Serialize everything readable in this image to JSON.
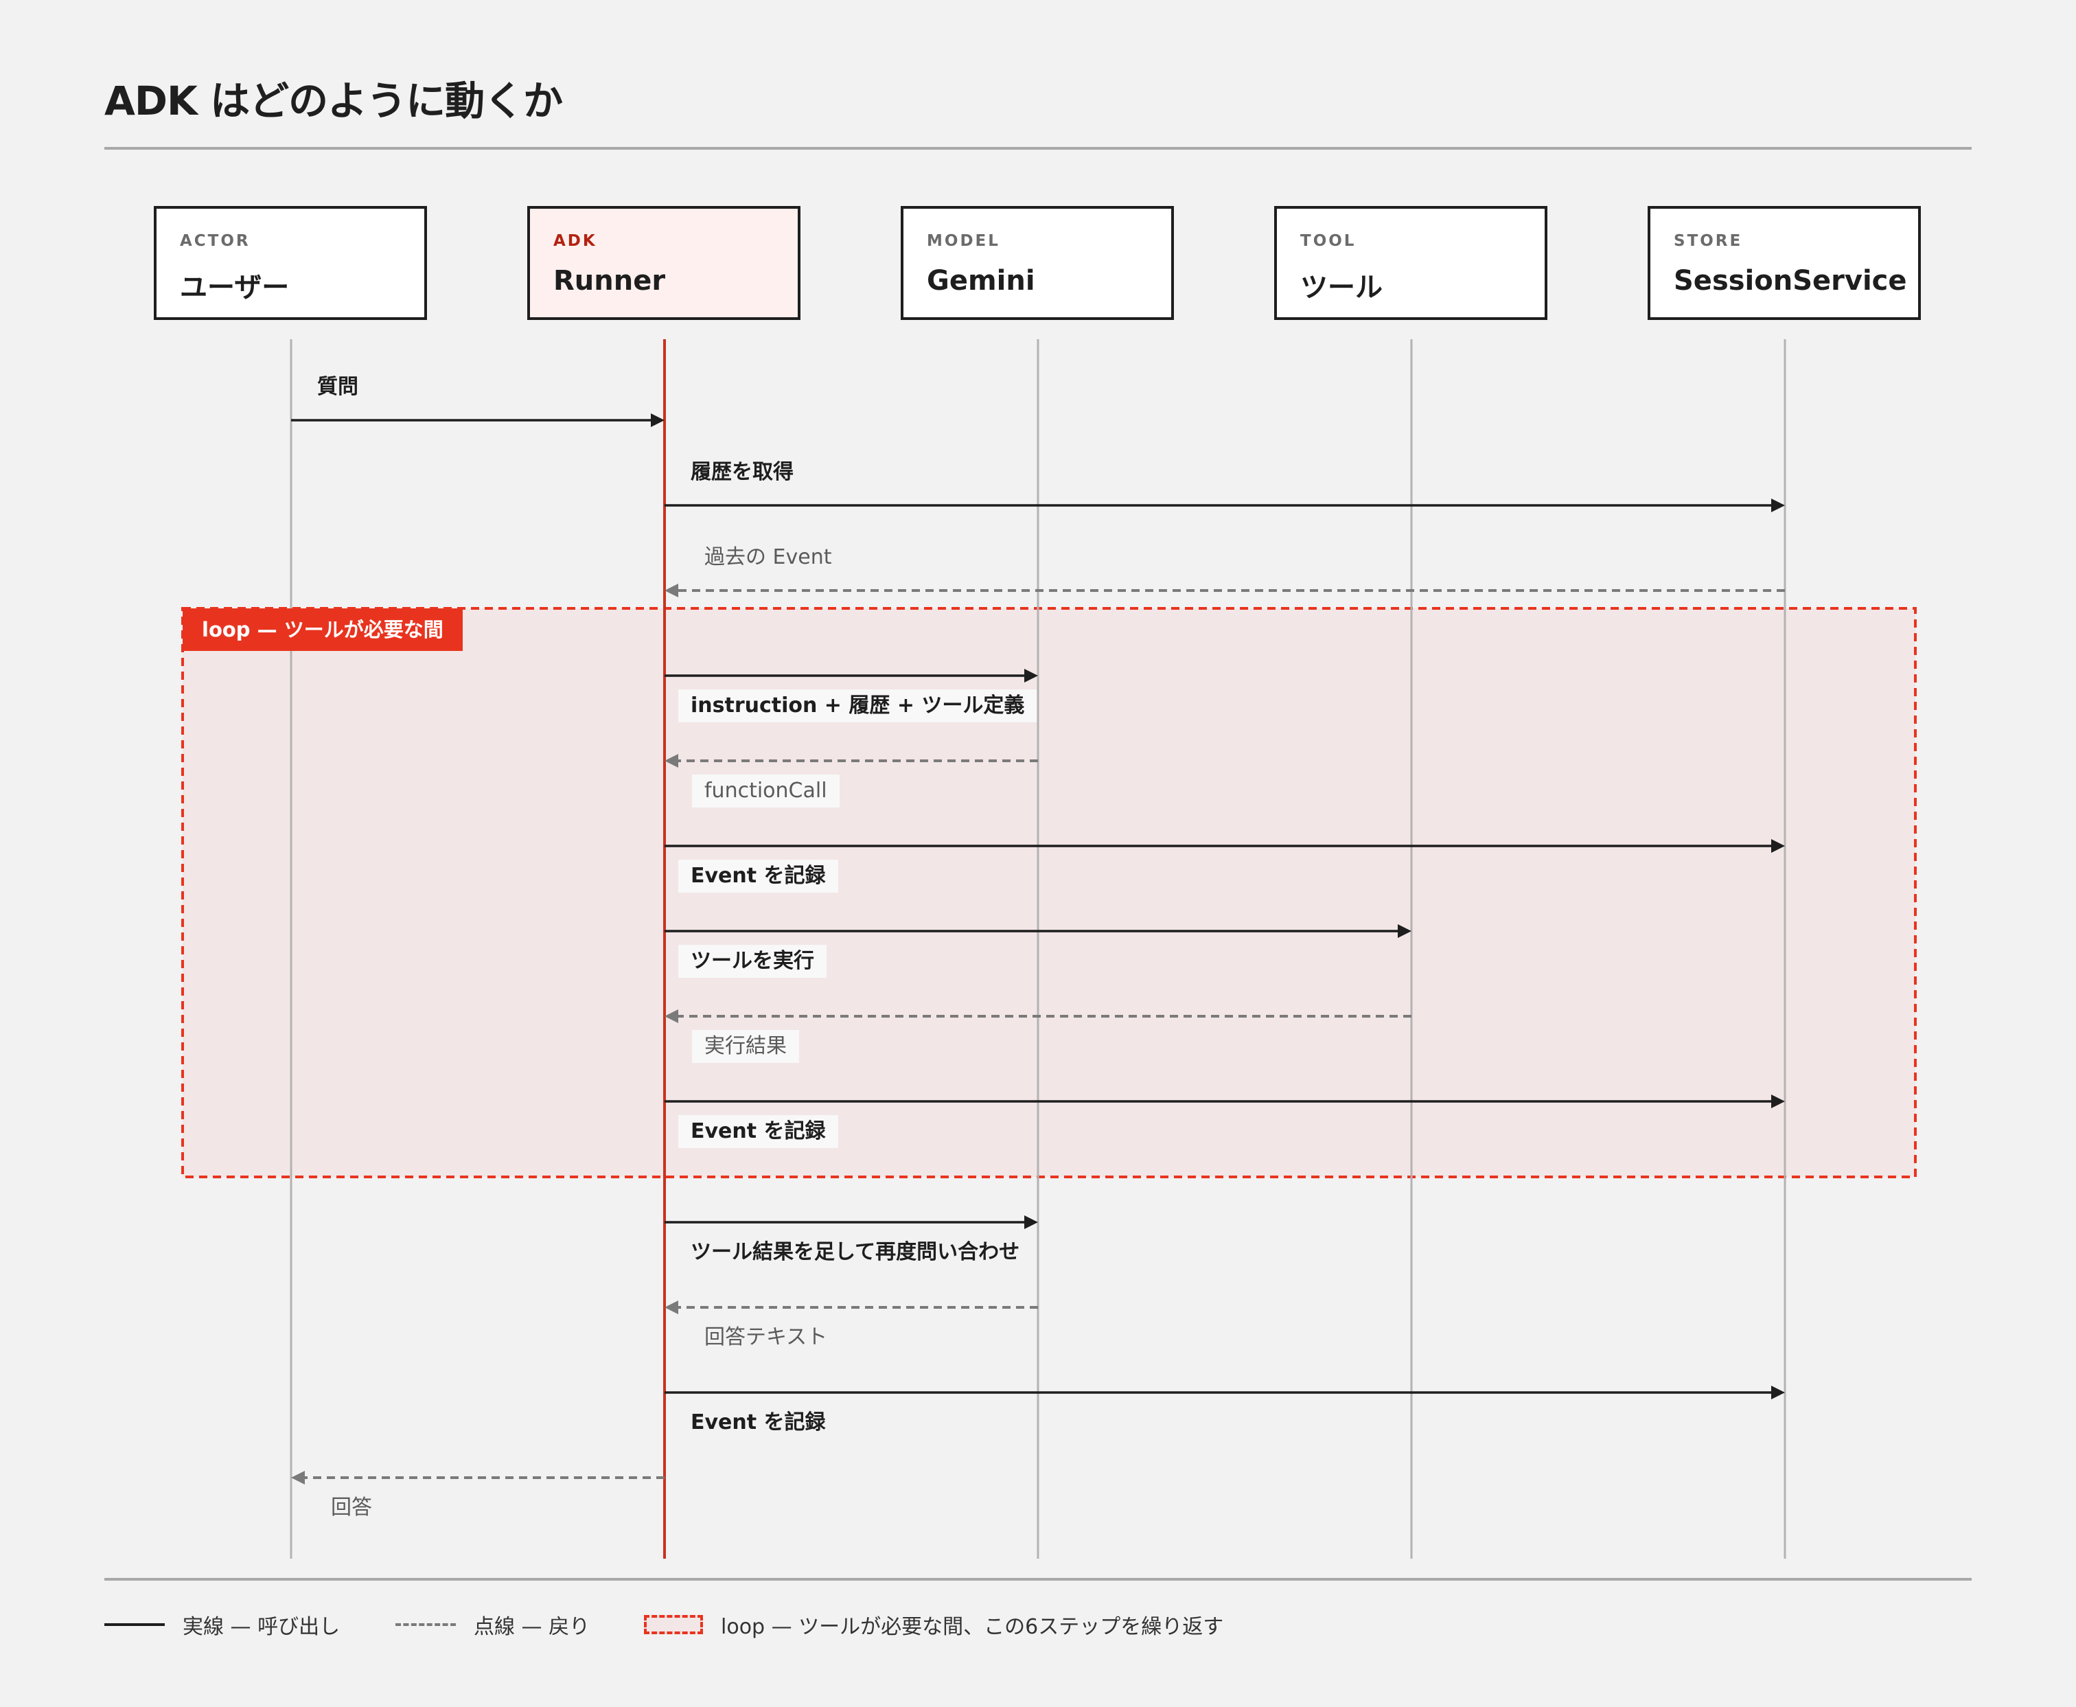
{
  "title": "ADK はどのように動くか",
  "actors": [
    {
      "kicker": "ACTOR",
      "name": "ユーザー"
    },
    {
      "kicker": "ADK",
      "name": "Runner"
    },
    {
      "kicker": "MODEL",
      "name": "Gemini"
    },
    {
      "kicker": "TOOL",
      "name": "ツール"
    },
    {
      "kicker": "STORE",
      "name": "SessionService"
    }
  ],
  "loop": {
    "label": "loop — ツールが必要な間"
  },
  "messages": [
    {
      "label": "質問",
      "from": 0,
      "to": 1,
      "kind": "call"
    },
    {
      "label": "履歴を取得",
      "from": 1,
      "to": 4,
      "kind": "call"
    },
    {
      "label": "過去の Event",
      "from": 4,
      "to": 1,
      "kind": "return"
    },
    {
      "label": "instruction + 履歴 + ツール定義",
      "from": 1,
      "to": 2,
      "kind": "call",
      "in_loop": true
    },
    {
      "label": "functionCall",
      "from": 2,
      "to": 1,
      "kind": "return",
      "in_loop": true
    },
    {
      "label": "Event を記録",
      "from": 1,
      "to": 4,
      "kind": "call",
      "in_loop": true
    },
    {
      "label": "ツールを実行",
      "from": 1,
      "to": 3,
      "kind": "call",
      "in_loop": true
    },
    {
      "label": "実行結果",
      "from": 3,
      "to": 1,
      "kind": "return",
      "in_loop": true
    },
    {
      "label": "Event を記録",
      "from": 1,
      "to": 4,
      "kind": "call",
      "in_loop": true
    },
    {
      "label": "ツール結果を足して再度問い合わせ",
      "from": 1,
      "to": 2,
      "kind": "call"
    },
    {
      "label": "回答テキスト",
      "from": 2,
      "to": 1,
      "kind": "return"
    },
    {
      "label": "Event を記録",
      "from": 1,
      "to": 4,
      "kind": "call"
    },
    {
      "label": "回答",
      "from": 1,
      "to": 0,
      "kind": "return"
    }
  ],
  "legend": {
    "solid": "実線 — 呼び出し",
    "dashed": "点線 — 戻り",
    "loop": "loop — ツールが必要な間、この6ステップを繰り返す"
  },
  "colors": {
    "accent": "#e8341f",
    "runner_line": "#c9321f",
    "call": "#1e1e1e",
    "return": "#7a7a7a",
    "loop_fill": "#f3e6e6",
    "background": "#f2f2f2"
  }
}
